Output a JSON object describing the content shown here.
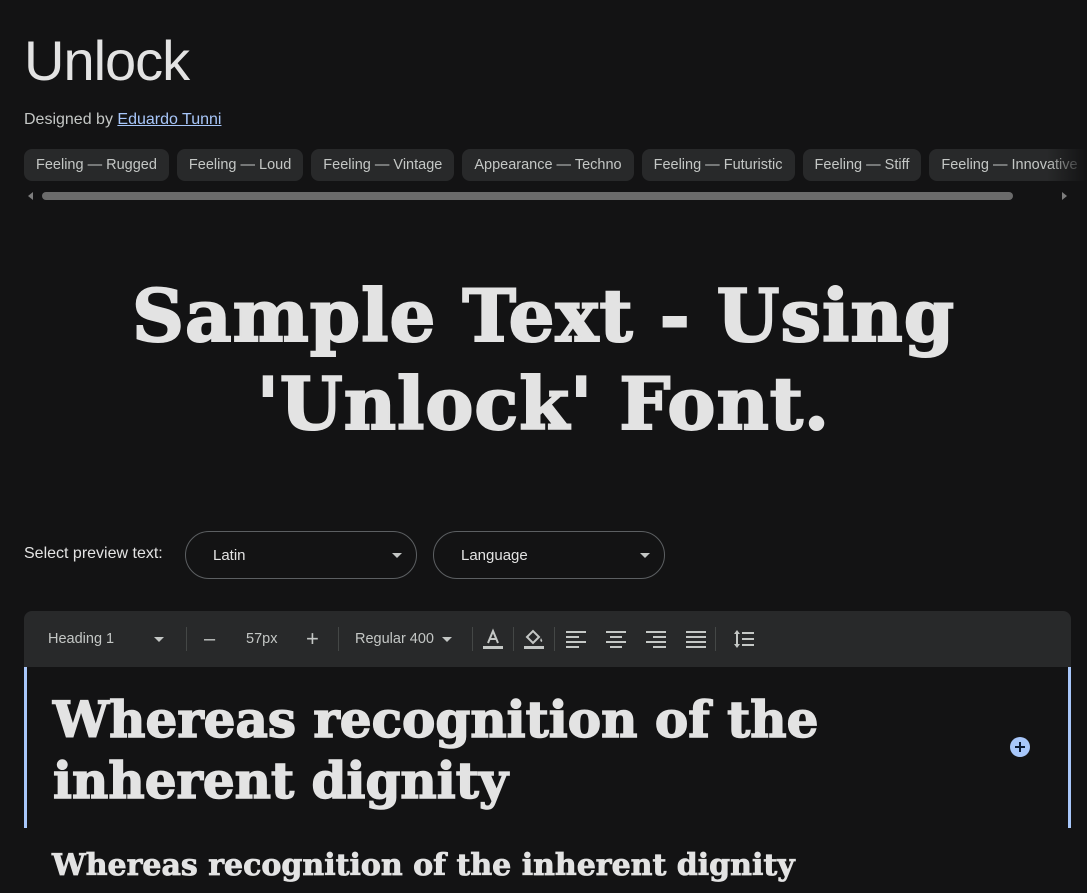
{
  "font": {
    "name": "Unlock",
    "designed_by_label": "Designed by",
    "designer": "Eduardo Tunni"
  },
  "tags": [
    "Feeling — Rugged",
    "Feeling — Loud",
    "Feeling — Vintage",
    "Appearance — Techno",
    "Feeling — Futuristic",
    "Feeling — Stiff",
    "Feeling — Innovative"
  ],
  "sample_text": {
    "line1": "Sample Text - Using",
    "line2": "'Unlock' Font."
  },
  "preview": {
    "label": "Select preview text:",
    "script_value": "Latin",
    "language_value": "Language"
  },
  "toolbar": {
    "style": "Heading 1",
    "decrease": "–",
    "size": "57px",
    "increase": "+",
    "weight": "Regular 400"
  },
  "editor": {
    "heading_text": "Whereas recognition of the inherent dignity",
    "body_text": "Whereas recognition of the inherent dignity"
  },
  "colors": {
    "background": "#131314",
    "accent": "#a8c7fa",
    "chip": "#28292a"
  }
}
